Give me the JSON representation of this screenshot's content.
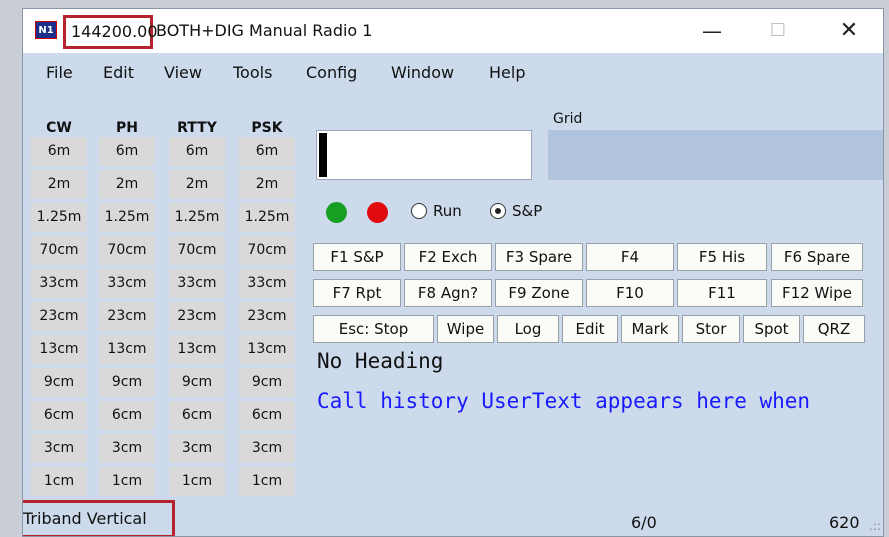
{
  "titlebar": {
    "icon_text": "N1",
    "frequency": "144200.00",
    "title": "BOTH+DIG Manual Radio 1",
    "minimize": "—",
    "maximize": "☐",
    "close": "✕"
  },
  "menu": [
    "File",
    "Edit",
    "View",
    "Tools",
    "Config",
    "Window",
    "Help"
  ],
  "bands": {
    "columns": [
      {
        "header": "CW",
        "cells": [
          "6m",
          "2m",
          "1.25m",
          "70cm",
          "33cm",
          "23cm",
          "13cm",
          "9cm",
          "6cm",
          "3cm",
          "1cm"
        ]
      },
      {
        "header": "PH",
        "cells": [
          "6m",
          "2m",
          "1.25m",
          "70cm",
          "33cm",
          "23cm",
          "13cm",
          "9cm",
          "6cm",
          "3cm",
          "1cm"
        ]
      },
      {
        "header": "RTTY",
        "cells": [
          "6m",
          "2m",
          "1.25m",
          "70cm",
          "33cm",
          "23cm",
          "13cm",
          "9cm",
          "6cm",
          "3cm",
          "1cm"
        ]
      },
      {
        "header": "PSK",
        "cells": [
          "6m",
          "2m",
          "1.25m",
          "70cm",
          "33cm",
          "23cm",
          "13cm",
          "9cm",
          "6cm",
          "3cm",
          "1cm"
        ]
      }
    ]
  },
  "grid_label": "Grid",
  "mode": {
    "run_label": "Run",
    "sp_label": "S&P",
    "selected": "S&P",
    "led_green": "#16a022",
    "led_red": "#e00a0f"
  },
  "function_keys": {
    "row1": [
      "F1 S&P",
      "F2 Exch",
      "F3 Spare",
      "F4",
      "F5 His",
      "F6 Spare"
    ],
    "row2": [
      "F7 Rpt",
      "F8 Agn?",
      "F9 Zone",
      "F10",
      "F11",
      "F12 Wipe"
    ],
    "row3": [
      "Esc: Stop",
      "Wipe",
      "Log",
      "Edit",
      "Mark",
      "Stor",
      "Spot",
      "QRZ"
    ]
  },
  "heading_text": "No Heading",
  "call_history_text": "Call history UserText appears here when",
  "statusbar": {
    "antenna": "Triband Vertical",
    "count": "6/0",
    "rate": "620",
    "grip": ".::"
  },
  "colors": {
    "window_bg": "#ccdaeb",
    "grid_box": "#b0c4de",
    "call_history_text": "#1a1aff",
    "highlight_border": "#b5232e"
  }
}
